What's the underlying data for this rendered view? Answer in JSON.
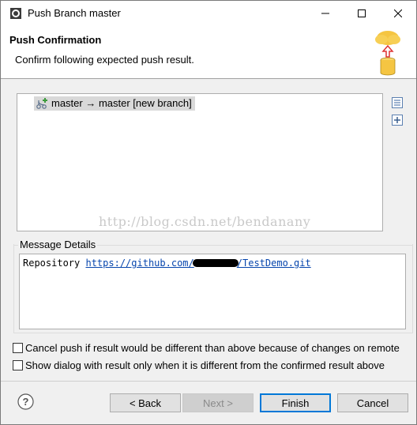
{
  "window": {
    "title": "Push Branch master"
  },
  "header": {
    "title": "Push Confirmation",
    "description": "Confirm following expected push result."
  },
  "results": {
    "items": [
      {
        "label": "master → master [new branch]"
      }
    ]
  },
  "watermark": "http://blog.csdn.net/bendanany",
  "message_details": {
    "label": "Message Details",
    "prefix": "Repository ",
    "url_start": "https://github.com/",
    "url_end": "/TestDemo.git"
  },
  "options": {
    "cancel_if_different": "Cancel push if result would be different than above because of changes on remote",
    "show_only_if_different": "Show dialog with result only when it is different from the confirmed result above"
  },
  "buttons": {
    "back": "< Back",
    "next": "Next >",
    "finish": "Finish",
    "cancel": "Cancel"
  },
  "colors": {
    "accent": "#0078d7",
    "link": "#0645ad"
  }
}
